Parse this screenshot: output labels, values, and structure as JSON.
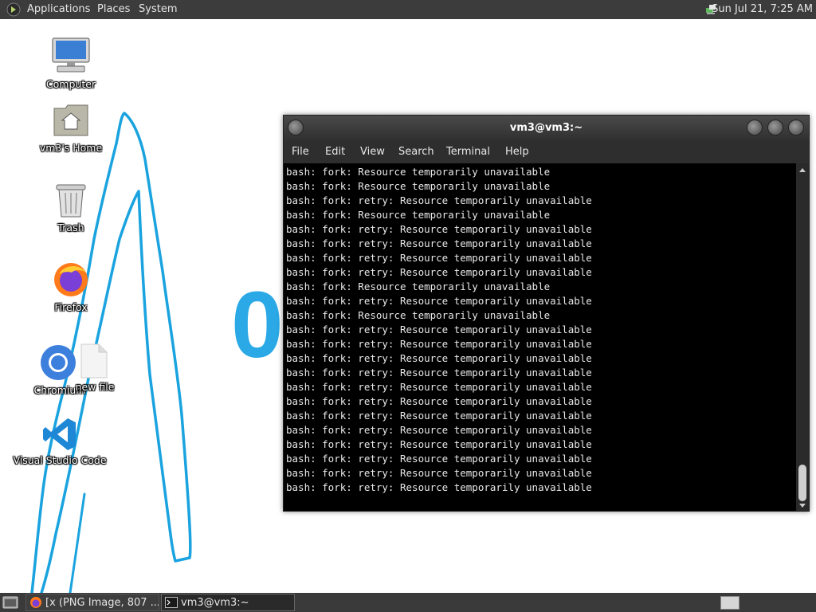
{
  "top_panel": {
    "menus": [
      "Applications",
      "Places",
      "System"
    ],
    "clock": "Sun Jul 21,  7:25 AM",
    "app_icon": "gnome-foot-icon",
    "network_icon": "network-icon"
  },
  "desktop": {
    "icons": [
      {
        "label": "Computer",
        "icon": "computer-icon"
      },
      {
        "label": "vm3's Home",
        "icon": "home-folder-icon"
      },
      {
        "label": "Trash",
        "icon": "trash-icon"
      },
      {
        "label": "Firefox",
        "icon": "firefox-icon"
      },
      {
        "label": "Chromium",
        "icon": "chromium-icon"
      },
      {
        "label": "new file",
        "icon": "file-icon"
      },
      {
        "label": "Visual Studio Code",
        "icon": "vscode-icon"
      }
    ],
    "background_text": "0"
  },
  "terminal": {
    "title": "vm3@vm3:~",
    "menu": [
      "File",
      "Edit",
      "View",
      "Search",
      "Terminal",
      "Help"
    ],
    "lines": [
      "bash: fork: Resource temporarily unavailable",
      "bash: fork: Resource temporarily unavailable",
      "bash: fork: retry: Resource temporarily unavailable",
      "bash: fork: Resource temporarily unavailable",
      "bash: fork: retry: Resource temporarily unavailable",
      "bash: fork: retry: Resource temporarily unavailable",
      "bash: fork: retry: Resource temporarily unavailable",
      "bash: fork: retry: Resource temporarily unavailable",
      "bash: fork: Resource temporarily unavailable",
      "bash: fork: retry: Resource temporarily unavailable",
      "bash: fork: Resource temporarily unavailable",
      "bash: fork: retry: Resource temporarily unavailable",
      "bash: fork: retry: Resource temporarily unavailable",
      "bash: fork: retry: Resource temporarily unavailable",
      "bash: fork: retry: Resource temporarily unavailable",
      "bash: fork: retry: Resource temporarily unavailable",
      "bash: fork: retry: Resource temporarily unavailable",
      "bash: fork: retry: Resource temporarily unavailable",
      "bash: fork: retry: Resource temporarily unavailable",
      "bash: fork: retry: Resource temporarily unavailable",
      "bash: fork: retry: Resource temporarily unavailable",
      "bash: fork: retry: Resource temporarily unavailable",
      "bash: fork: retry: Resource temporarily unavailable"
    ]
  },
  "taskbar": {
    "tasks": [
      {
        "label": "[x (PNG Image, 807 ...",
        "icon": "firefox-icon",
        "active": false
      },
      {
        "label": "vm3@vm3:~",
        "icon": "terminal-icon",
        "active": true
      }
    ],
    "show_desktop_icon": "show-desktop-icon",
    "workspace_icon": "workspace-switcher-icon"
  },
  "colors": {
    "panel": "#3c3c3c",
    "annotation_stroke": "#1aa3df",
    "terminal_bg": "#000000",
    "terminal_fg": "#e8e8e8"
  }
}
